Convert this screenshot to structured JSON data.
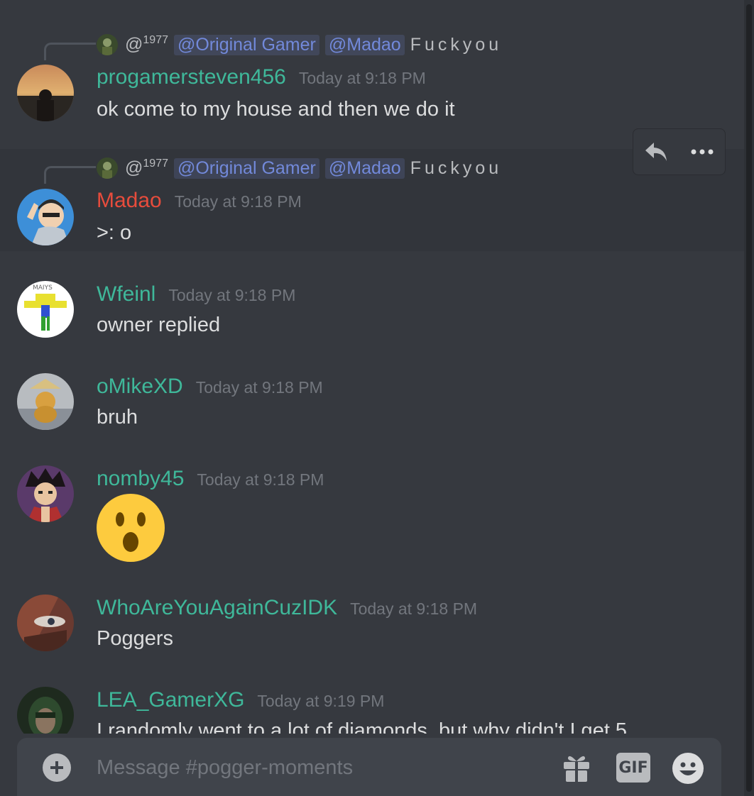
{
  "channel": {
    "composer_placeholder": "Message #pogger-moments",
    "gif_label": "GIF"
  },
  "reply_ref": {
    "handle": "@",
    "handle_sup": "1977",
    "mentions": [
      "@Original Gamer",
      "@Madao"
    ],
    "text": "Fuckyou"
  },
  "messages": [
    {
      "username": "progamersteven456",
      "timestamp": "Today at 9:18 PM",
      "text": "ok come to my house and then we do it"
    },
    {
      "username": "Madao",
      "timestamp": "Today at 9:18 PM",
      "text": ">: o"
    },
    {
      "username": "Wfeinl",
      "timestamp": "Today at 9:18 PM",
      "text": "owner replied"
    },
    {
      "username": "oMikeXD",
      "timestamp": "Today at 9:18 PM",
      "text": "bruh"
    },
    {
      "username": "nomby45",
      "timestamp": "Today at 9:18 PM",
      "text": ""
    },
    {
      "username": "WhoAreYouAgainCuzIDK",
      "timestamp": "Today at 9:18 PM",
      "text": "Poggers"
    },
    {
      "username": "LEA_GamerXG",
      "timestamp": "Today at 9:19 PM",
      "text": "I randomly went to a lot of diamonds, but why didn't I get 5"
    }
  ],
  "colors": {
    "background": "#36393f",
    "teal_name": "#3fb89a",
    "red_name": "#e74c3c",
    "mention": "#7289da"
  },
  "icons": {
    "reply": "reply-arrow-icon",
    "more": "more-dots-icon",
    "plus": "plus-icon",
    "gift": "gift-icon",
    "gif": "gif-icon",
    "emoji": "emoji-smile-icon",
    "wow": "open-mouth-emoji"
  }
}
